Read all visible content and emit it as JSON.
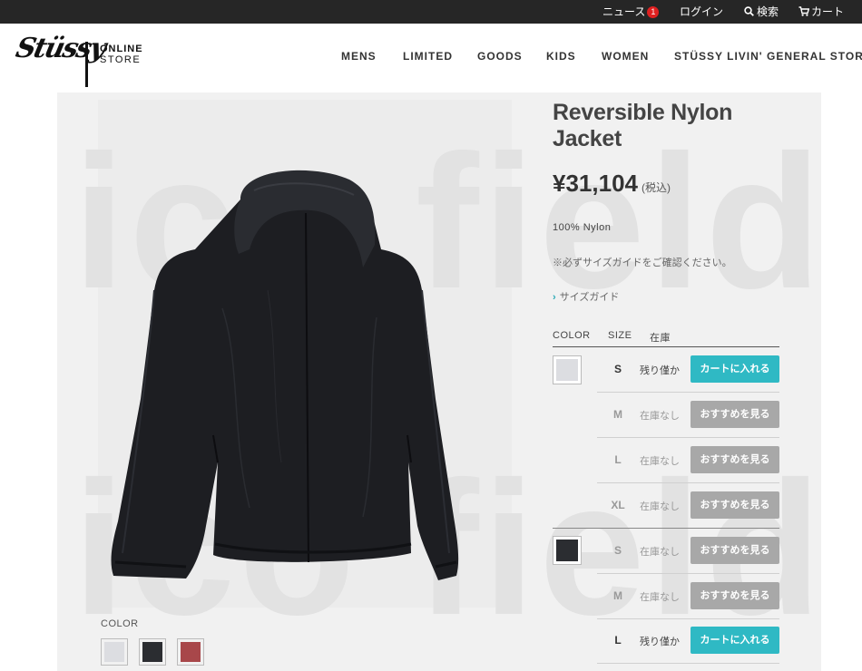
{
  "topbar": {
    "news": "ニュース",
    "news_count": "1",
    "login": "ログイン",
    "search": "検索",
    "cart": "カート"
  },
  "logo": {
    "brand": "Stüssy",
    "online": "ONLINE",
    "store": "STORE"
  },
  "nav": [
    "MENS",
    "LIMITED",
    "GOODS",
    "KIDS",
    "WOMEN",
    "STÜSSY LIVIN' GENERAL STORE"
  ],
  "watermark": [
    "ico field",
    "ico field"
  ],
  "product": {
    "title": "Reversible Nylon Jacket",
    "price": "¥31,104",
    "tax": "(税込)",
    "material": "100% Nylon",
    "note": "※必ずサイズガイドをご確認ください。",
    "size_guide": "サイズガイド"
  },
  "gallery": {
    "color_label": "COLOR",
    "thumbs": [
      {
        "color": "#dcdde1"
      },
      {
        "color": "#2b2d31"
      },
      {
        "color": "#a8474a"
      }
    ]
  },
  "table": {
    "headers": [
      "COLOR",
      "SIZE",
      "在庫"
    ],
    "colors": {
      "light_gray": "#dcdde1",
      "charcoal": "#2b2d31"
    },
    "rows": [
      {
        "size": "S",
        "stock": "残り僅か",
        "action": "カートに入れる",
        "available": true
      },
      {
        "size": "M",
        "stock": "在庫なし",
        "action": "おすすめを見る",
        "available": false
      },
      {
        "size": "L",
        "stock": "在庫なし",
        "action": "おすすめを見る",
        "available": false
      },
      {
        "size": "XL",
        "stock": "在庫なし",
        "action": "おすすめを見る",
        "available": false
      },
      {
        "size": "S",
        "stock": "在庫なし",
        "action": "おすすめを見る",
        "available": false
      },
      {
        "size": "M",
        "stock": "在庫なし",
        "action": "おすすめを見る",
        "available": false
      },
      {
        "size": "L",
        "stock": "残り僅か",
        "action": "カートに入れる",
        "available": true
      }
    ]
  }
}
